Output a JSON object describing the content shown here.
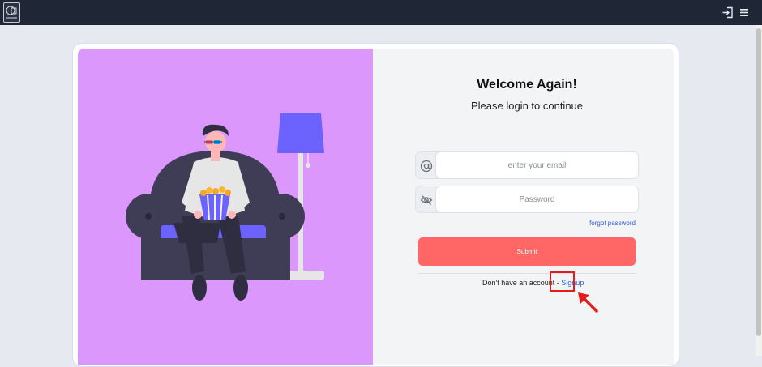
{
  "topbar": {
    "logo_icon": "app-logo",
    "login_icon": "login-icon",
    "menu_icon": "hamburger-menu-icon",
    "background": "#1f2635"
  },
  "illustration": {
    "icon": "person-watching-3d-movie-on-couch",
    "background": "#db97fb"
  },
  "login": {
    "title": "Welcome Again!",
    "subtitle": "Please login to continue",
    "email_icon": "at-sign-icon",
    "email_placeholder": "enter your email",
    "email_value": "",
    "password_icon": "eye-off-icon",
    "password_placeholder": "Password",
    "password_value": "",
    "forgot_label": "forgot password",
    "submit_label": "Submit",
    "signup_prompt": "Don't have an account -",
    "signup_label": "Signup",
    "accent": "#ff6767",
    "link_color": "#2f5fd0"
  },
  "annotation": {
    "highlight_color": "#e51b1b",
    "arrow_icon": "red-pointer-arrow"
  }
}
